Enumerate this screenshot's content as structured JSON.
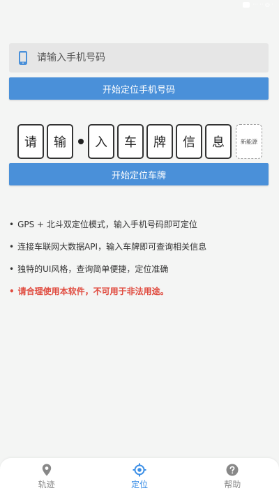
{
  "colors": {
    "accent": "#4a90d9",
    "warning": "#e04b3f",
    "tab_active": "#3a8ee6",
    "background": "#f4f5f4"
  },
  "status_bar": {
    "text": "··· ·· ◎ ·"
  },
  "phone": {
    "icon": "phone-icon",
    "placeholder": "请输入手机号码",
    "value": "",
    "button_label": "开始定位手机号码"
  },
  "plate": {
    "chars": [
      "请",
      "输",
      "入",
      "车",
      "牌",
      "信",
      "息"
    ],
    "new_energy_label": "新能源",
    "button_label": "开始定位车牌"
  },
  "tips": [
    "GPS + 北斗双定位模式，输入手机号码即可定位",
    "连接车联网大数据API，输入车牌即可查询相关信息",
    "独特的UI风格，查询简单便捷，定位准确",
    "请合理使用本软件，不可用于非法用途。"
  ],
  "bullet": "•",
  "tabs": [
    {
      "label": "轨迹",
      "icon": "location-pin-icon"
    },
    {
      "label": "定位",
      "icon": "target-icon"
    },
    {
      "label": "帮助",
      "icon": "help-icon"
    }
  ]
}
